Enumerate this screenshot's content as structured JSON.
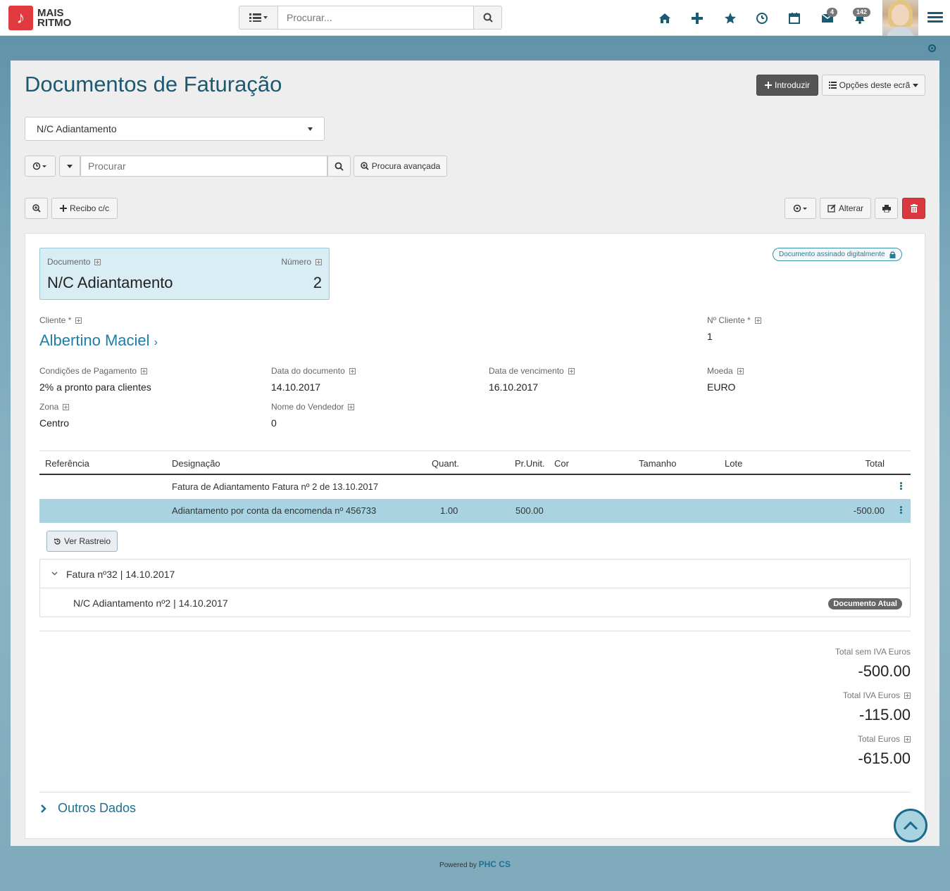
{
  "brand": {
    "line1": "MAIS",
    "line2": "RITMO"
  },
  "top_search": {
    "placeholder": "Procurar..."
  },
  "badges": {
    "mail": "4",
    "notifications": "142"
  },
  "page": {
    "title": "Documentos de Faturação",
    "btn_introduzir": "Introduzir",
    "btn_opcoes": "Opções deste ecrã",
    "doc_type_selected": "N/C Adiantamento",
    "search_placeholder": "Procurar",
    "btn_advanced": "Procura avançada",
    "btn_recibo": "Recibo c/c",
    "btn_alterar": "Alterar"
  },
  "document": {
    "doc_label": "Documento",
    "doc_value": "N/C Adiantamento",
    "num_label": "Número",
    "num_value": "2",
    "signed_label": "Documento assinado digitalmente",
    "client_label": "Cliente *",
    "client_value": "Albertino Maciel",
    "client_no_label": "Nº Cliente *",
    "client_no_value": "1",
    "payment_label": "Condições de Pagamento",
    "payment_value": "2% a pronto para clientes",
    "date_label": "Data do documento",
    "date_value": "14.10.2017",
    "due_label": "Data de vencimento",
    "due_value": "16.10.2017",
    "currency_label": "Moeda",
    "currency_value": "EURO",
    "zone_label": "Zona",
    "zone_value": "Centro",
    "seller_label": "Nome do Vendedor",
    "seller_value": "0"
  },
  "table": {
    "headers": [
      "Referência",
      "Designação",
      "Quant.",
      "Pr.Unit.",
      "Cor",
      "Tamanho",
      "Lote",
      "Total"
    ],
    "rows": [
      {
        "designacao": "Fatura de Adiantamento Fatura nº 2 de 13.10.2017",
        "quant": "",
        "prunit": "",
        "total": ""
      },
      {
        "designacao": "Adiantamento por conta da encomenda nº 456733",
        "quant": "1.00",
        "prunit": "500.00",
        "total": "-500.00"
      }
    ]
  },
  "tracking": {
    "button": "Ver Rastreio",
    "parent": "Fatura nº32 | 14.10.2017",
    "child": "N/C Adiantamento nº2 | 14.10.2017",
    "current_badge": "Documento Atual"
  },
  "totals": {
    "sem_iva_label": "Total sem IVA Euros",
    "sem_iva_value": "-500.00",
    "iva_label": "Total IVA Euros",
    "iva_value": "-115.00",
    "total_label": "Total Euros",
    "total_value": "-615.00"
  },
  "outros_dados": "Outros Dados",
  "footer": {
    "powered": "Powered by",
    "brand": "PHC CS"
  }
}
